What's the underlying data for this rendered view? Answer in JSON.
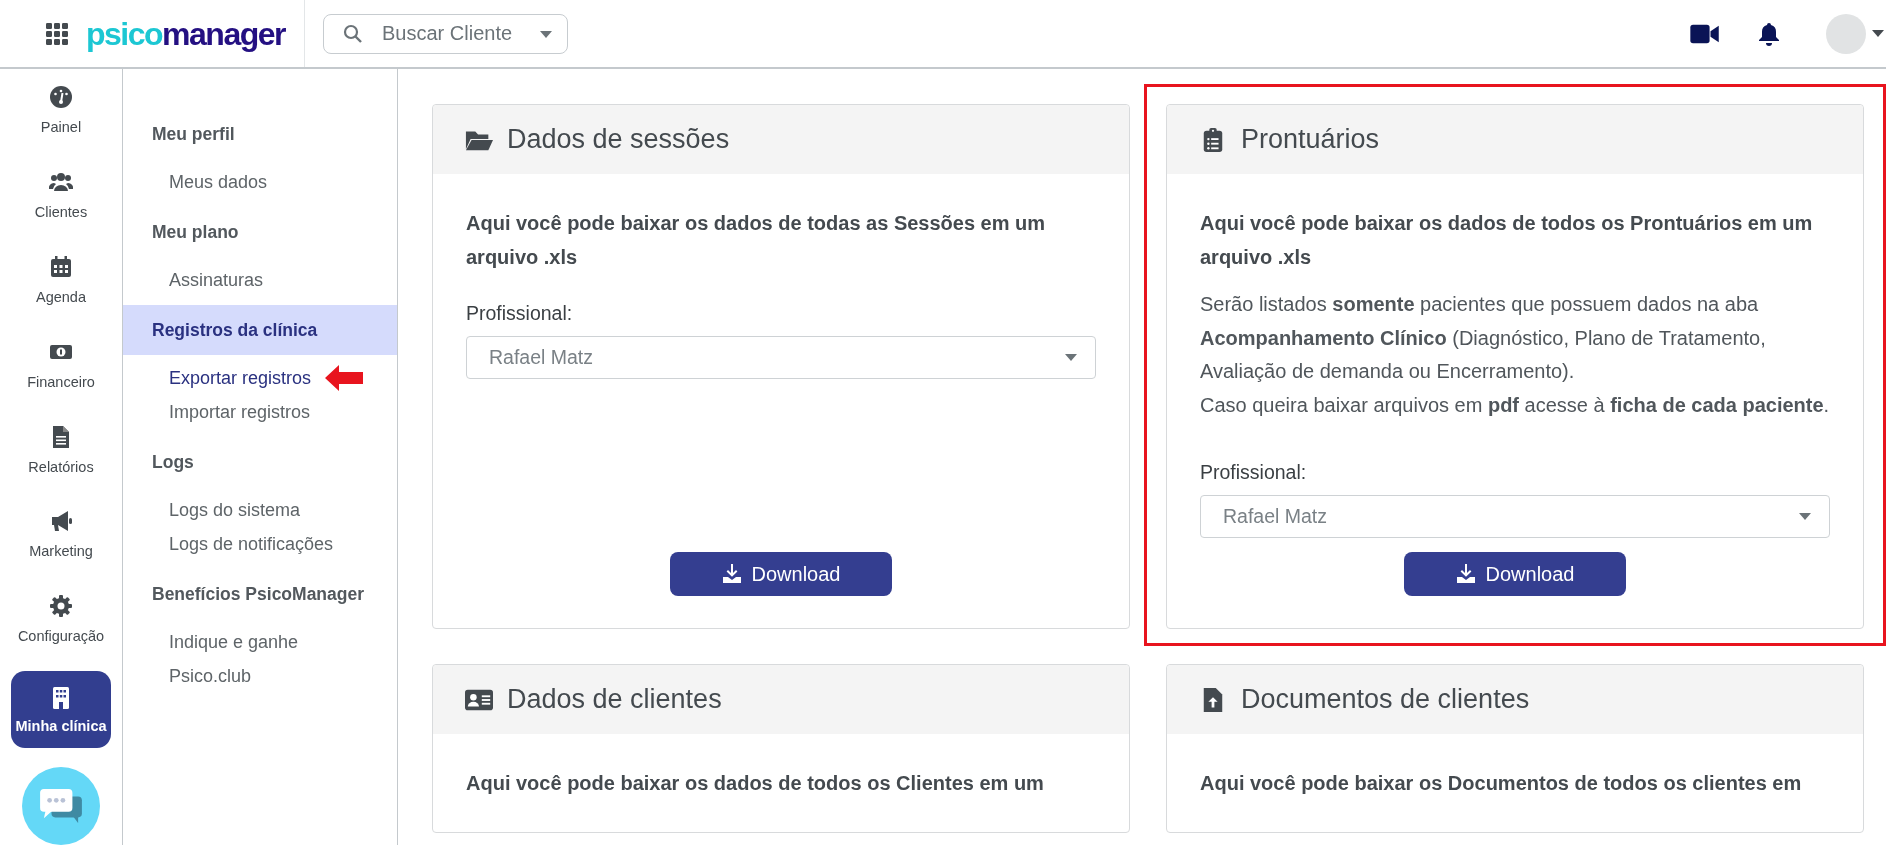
{
  "topbar": {
    "logo": {
      "prefix": "psico",
      "suffix": "manager"
    },
    "search": {
      "placeholder": "Buscar Cliente"
    }
  },
  "rail": [
    {
      "label": "Painel",
      "selected": false
    },
    {
      "label": "Clientes",
      "selected": false
    },
    {
      "label": "Agenda",
      "selected": false
    },
    {
      "label": "Financeiro",
      "selected": false
    },
    {
      "label": "Relatórios",
      "selected": false
    },
    {
      "label": "Marketing",
      "selected": false
    },
    {
      "label": "Configuração",
      "selected": false
    },
    {
      "label": "Minha clínica",
      "selected": true
    }
  ],
  "submenu": [
    {
      "title": "Meu perfil",
      "selected": false,
      "items": [
        {
          "label": "Meus dados",
          "selected": false,
          "pointed": false
        }
      ]
    },
    {
      "title": "Meu plano",
      "selected": false,
      "items": [
        {
          "label": "Assinaturas",
          "selected": false,
          "pointed": false
        }
      ]
    },
    {
      "title": "Registros da clínica",
      "selected": true,
      "items": [
        {
          "label": "Exportar registros",
          "selected": true,
          "pointed": true
        },
        {
          "label": "Importar registros",
          "selected": false,
          "pointed": false
        }
      ]
    },
    {
      "title": "Logs",
      "selected": false,
      "items": [
        {
          "label": "Logs do sistema",
          "selected": false,
          "pointed": false
        },
        {
          "label": "Logs de notificações",
          "selected": false,
          "pointed": false
        }
      ]
    },
    {
      "title": "Benefícios PsicoManager",
      "selected": false,
      "items": [
        {
          "label": "Indique e ganhe",
          "selected": false,
          "pointed": false
        },
        {
          "label": "Psico.club",
          "selected": false,
          "pointed": false
        }
      ]
    }
  ],
  "cards": [
    {
      "title": "Dados de sessões",
      "highlighted": false,
      "intro": "Aqui você pode baixar os dados de todas as Sessões em um arquivo .xls",
      "field_label": "Profissional:",
      "value": "Rafael Matz",
      "button": "Download"
    },
    {
      "title": "Prontuários",
      "highlighted": true,
      "intro": "Aqui você pode baixar os dados de todos os Prontuários em um arquivo .xls",
      "notes": [
        "Serão listados **somente** pacientes que possuem dados na aba **Acompanhamento Clínico** (Diagnóstico, Plano de Tratamento, Avaliação de demanda ou Encerramento).",
        "Caso queira baixar arquivos em **pdf** acesse à **ficha de cada paciente**."
      ],
      "field_label": "Profissional:",
      "value": "Rafael Matz",
      "button": "Download"
    },
    {
      "title": "Dados de clientes",
      "highlighted": false,
      "intro": "Aqui você pode baixar os dados de todos os Clientes em um"
    },
    {
      "title": "Documentos de clientes",
      "highlighted": false,
      "intro": "Aqui você pode baixar os Documentos de todos os clientes em"
    }
  ]
}
